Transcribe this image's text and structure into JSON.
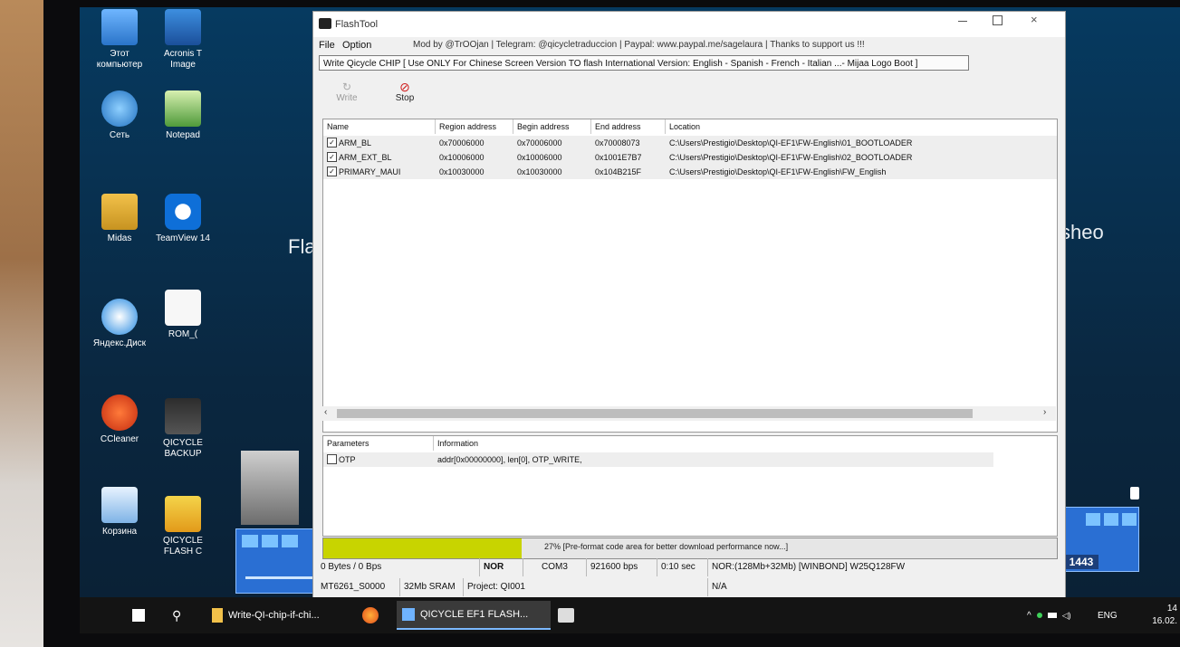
{
  "desktop": {
    "icons_left": [
      {
        "label": "Этот компьютер",
        "icon": "this-pc-icon"
      },
      {
        "label": "Сеть",
        "icon": "network-icon"
      },
      {
        "label": "Midas",
        "icon": "folder-user-icon"
      },
      {
        "label": "Яндекс.Диск",
        "icon": "yandex-disk-icon"
      },
      {
        "label": "CCleaner",
        "icon": "ccleaner-icon"
      },
      {
        "label": "Корзина",
        "icon": "recycle-bin-icon"
      }
    ],
    "icons_right": [
      {
        "label": "Acronis T Image",
        "icon": "acronis-icon"
      },
      {
        "label": "Notepad",
        "icon": "notepad-icon"
      },
      {
        "label": "TeamView 14",
        "icon": "teamviewer-icon"
      },
      {
        "label": "ROM_(",
        "icon": "file-icon"
      },
      {
        "label": "QICYCLE BACKUP",
        "icon": "folder-icon"
      },
      {
        "label": "QICYCLE FLASH C",
        "icon": "folder-icon"
      }
    ],
    "background_text_left": "Fla",
    "background_text_right": "sheo",
    "player_right_time": "1443"
  },
  "taskbar": {
    "items": [
      {
        "label": "Write-QI-chip-if-chi...",
        "icon": "folder-icon"
      },
      {
        "label": "",
        "icon": "firefox-icon"
      },
      {
        "label": "QICYCLE EF1 FLASH...",
        "icon": "flashtool-icon"
      },
      {
        "label": "",
        "icon": "flashtool-icon"
      }
    ],
    "tray_lang": "ENG",
    "clock_time": "14",
    "clock_date": "16.02."
  },
  "window": {
    "title": "FlashTool",
    "menu": [
      "File",
      "Option"
    ],
    "menu_message": "Mod by @TrOOjan | Telegram: @qicycletraduccion | Paypal:  www.paypal.me/sagelaura   | Thanks to support us !!!",
    "banner": "Write Qicycle CHIP [ Use ONLY For Chinese Screen Version TO flash International Version: English - Spanish - French - Italian ...- Mijaa Logo Boot ]",
    "toolbar": {
      "write_label": "Write",
      "stop_label": "Stop"
    },
    "grid": {
      "headers": [
        "Name",
        "Region address",
        "Begin address",
        "End address",
        "Location"
      ],
      "rows": [
        {
          "name": "ARM_BL",
          "region": "0x70006000",
          "begin": "0x70006000",
          "end": "0x70008073",
          "location": "C:\\Users\\Prestigio\\Desktop\\QI-EF1\\FW-English\\01_BOOTLOADER",
          "checked": true
        },
        {
          "name": "ARM_EXT_BL",
          "region": "0x10006000",
          "begin": "0x10006000",
          "end": "0x1001E7B7",
          "location": "C:\\Users\\Prestigio\\Desktop\\QI-EF1\\FW-English\\02_BOOTLOADER",
          "checked": true
        },
        {
          "name": "PRIMARY_MAUI",
          "region": "0x10030000",
          "begin": "0x10030000",
          "end": "0x104B215F",
          "location": "C:\\Users\\Prestigio\\Desktop\\QI-EF1\\FW-English\\FW_English",
          "checked": true
        }
      ]
    },
    "params": {
      "headers": [
        "Parameters",
        "Information"
      ],
      "rows": [
        {
          "name": "OTP",
          "info": "addr[0x00000000], len[0], OTP_WRITE,",
          "checked": false
        }
      ]
    },
    "progress": {
      "percent": 27,
      "text": "27% [Pre-format code area for better download performance now...]",
      "color": "#c8d400"
    },
    "status1": [
      "0 Bytes / 0 Bps",
      "NOR",
      "COM3",
      "921600 bps",
      "0:10 sec",
      "NOR:(128Mb+32Mb) [WINBOND] W25Q128FW"
    ],
    "status2": [
      "MT6261_S0000",
      "32Mb SRAM",
      "Project: QI001",
      "N/A"
    ]
  },
  "colors": {
    "wallpaper": "#063a60",
    "taskbar": "#141414",
    "progress_fill": "#c8d400",
    "player": "#2a6fd3"
  }
}
